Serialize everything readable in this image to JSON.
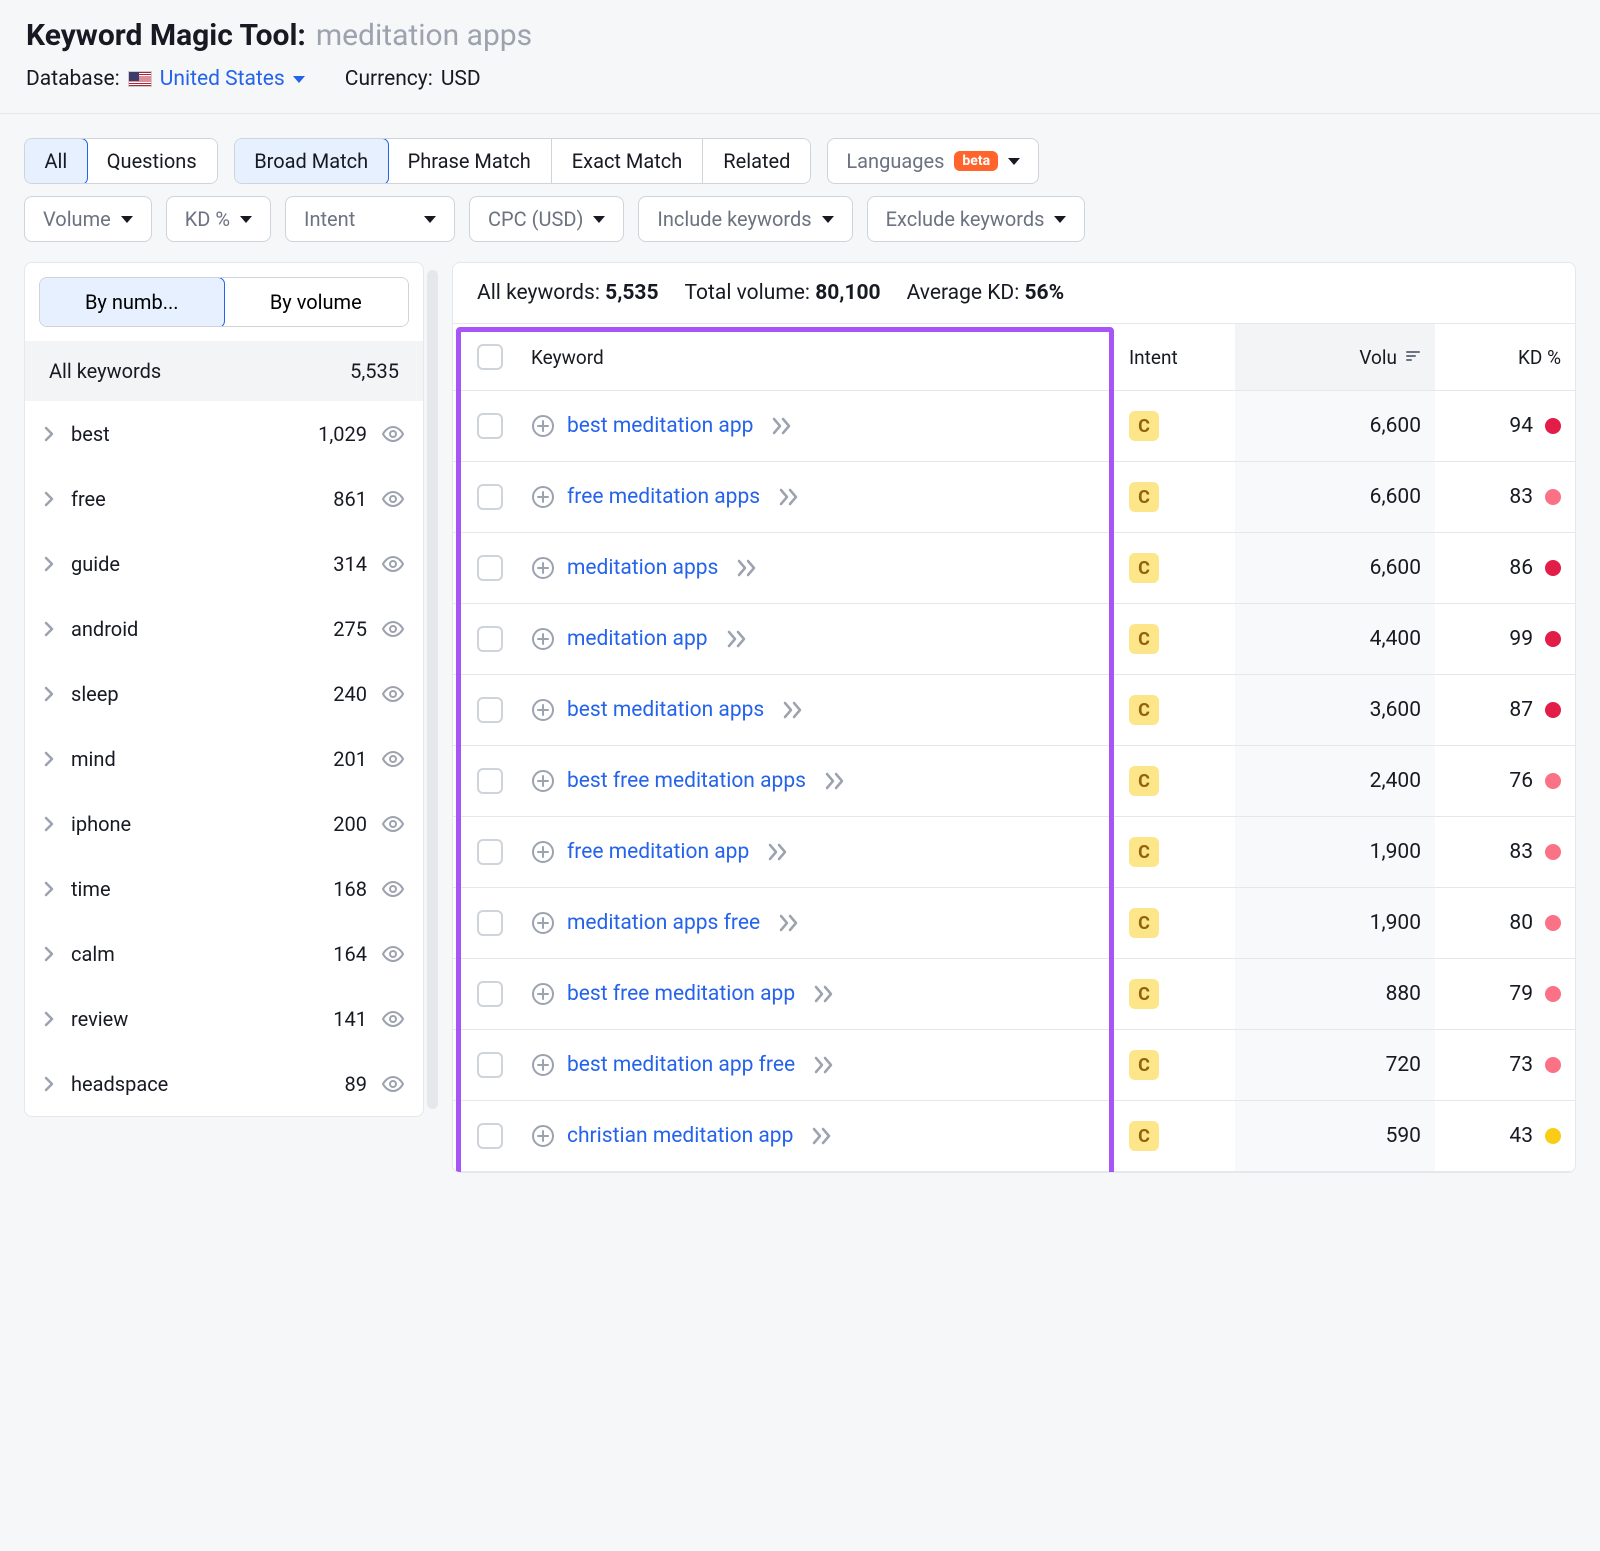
{
  "header": {
    "title": "Keyword Magic Tool:",
    "query": "meditation apps",
    "database_label": "Database:",
    "database_value": "United States",
    "currency_label": "Currency:",
    "currency_value": "USD"
  },
  "tabs1": {
    "all": "All",
    "questions": "Questions"
  },
  "tabs2": {
    "broad": "Broad Match",
    "phrase": "Phrase Match",
    "exact": "Exact Match",
    "related": "Related"
  },
  "lang": {
    "label": "Languages",
    "badge": "beta"
  },
  "filters": {
    "volume": "Volume",
    "kd": "KD %",
    "intent": "Intent",
    "cpc": "CPC (USD)",
    "include": "Include keywords",
    "exclude": "Exclude keywords"
  },
  "sidebar": {
    "sort_by_number": "By numb...",
    "sort_by_volume": "By volume",
    "all_kw_label": "All keywords",
    "all_kw_count": "5,535",
    "groups": [
      {
        "label": "best",
        "count": "1,029"
      },
      {
        "label": "free",
        "count": "861"
      },
      {
        "label": "guide",
        "count": "314"
      },
      {
        "label": "android",
        "count": "275"
      },
      {
        "label": "sleep",
        "count": "240"
      },
      {
        "label": "mind",
        "count": "201"
      },
      {
        "label": "iphone",
        "count": "200"
      },
      {
        "label": "time",
        "count": "168"
      },
      {
        "label": "calm",
        "count": "164"
      },
      {
        "label": "review",
        "count": "141"
      },
      {
        "label": "headspace",
        "count": "89"
      }
    ]
  },
  "summary": {
    "all_kw_label": "All keywords:",
    "all_kw_value": "5,535",
    "total_vol_label": "Total volume:",
    "total_vol_value": "80,100",
    "avg_kd_label": "Average KD:",
    "avg_kd_value": "56%"
  },
  "columns": {
    "keyword": "Keyword",
    "intent": "Intent",
    "volume": "Volu",
    "kd": "KD %"
  },
  "rows": [
    {
      "kw": "best meditation app",
      "intent": "C",
      "vol": "6,600",
      "kd": "94",
      "dot": "red"
    },
    {
      "kw": "free meditation apps",
      "intent": "C",
      "vol": "6,600",
      "kd": "83",
      "dot": "orange"
    },
    {
      "kw": "meditation apps",
      "intent": "C",
      "vol": "6,600",
      "kd": "86",
      "dot": "red"
    },
    {
      "kw": "meditation app",
      "intent": "C",
      "vol": "4,400",
      "kd": "99",
      "dot": "red"
    },
    {
      "kw": "best meditation apps",
      "intent": "C",
      "vol": "3,600",
      "kd": "87",
      "dot": "red"
    },
    {
      "kw": "best free meditation apps",
      "intent": "C",
      "vol": "2,400",
      "kd": "76",
      "dot": "orange"
    },
    {
      "kw": "free meditation app",
      "intent": "C",
      "vol": "1,900",
      "kd": "83",
      "dot": "orange"
    },
    {
      "kw": "meditation apps free",
      "intent": "C",
      "vol": "1,900",
      "kd": "80",
      "dot": "orange"
    },
    {
      "kw": "best free meditation app",
      "intent": "C",
      "vol": "880",
      "kd": "79",
      "dot": "orange"
    },
    {
      "kw": "best meditation app free",
      "intent": "C",
      "vol": "720",
      "kd": "73",
      "dot": "orange"
    },
    {
      "kw": "christian meditation app",
      "intent": "C",
      "vol": "590",
      "kd": "43",
      "dot": "yellow"
    }
  ]
}
